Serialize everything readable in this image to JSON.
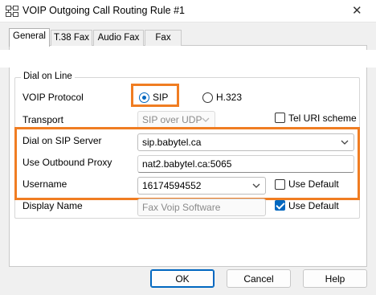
{
  "window": {
    "title": "VOIP Outgoing Call Routing Rule #1",
    "icon": "network-app-icon",
    "close_glyph": "✕"
  },
  "tabs": [
    {
      "label": "General",
      "active": true
    },
    {
      "label": "T.38 Fax",
      "active": false
    },
    {
      "label": "Audio Fax",
      "active": false
    },
    {
      "label": "Fax",
      "active": false
    }
  ],
  "dial_on_line": {
    "group_label": "Dial on Line",
    "voip_protocol": {
      "label": "VOIP Protocol",
      "options": [
        "SIP",
        "H.323"
      ],
      "selected": "SIP"
    },
    "transport": {
      "label": "Transport",
      "value": "SIP over UDP",
      "enabled": false
    },
    "tel_uri": {
      "label": "Tel URI scheme",
      "checked": false
    },
    "sip_server": {
      "label": "Dial on SIP Server",
      "value": "sip.babytel.ca"
    },
    "outbound_proxy": {
      "label": "Use Outbound Proxy",
      "value": "nat2.babytel.ca:5065"
    },
    "username": {
      "label": "Username",
      "value": "16174594552",
      "use_default_label": "Use Default",
      "use_default_checked": false
    },
    "display_name": {
      "label": "Display Name",
      "value": "Fax Voip Software",
      "enabled": false,
      "use_default_label": "Use Default",
      "use_default_checked": true
    }
  },
  "buttons": {
    "ok": "OK",
    "cancel": "Cancel",
    "help": "Help"
  },
  "colors": {
    "highlight": "#f07d22",
    "accent": "#0067c0"
  }
}
